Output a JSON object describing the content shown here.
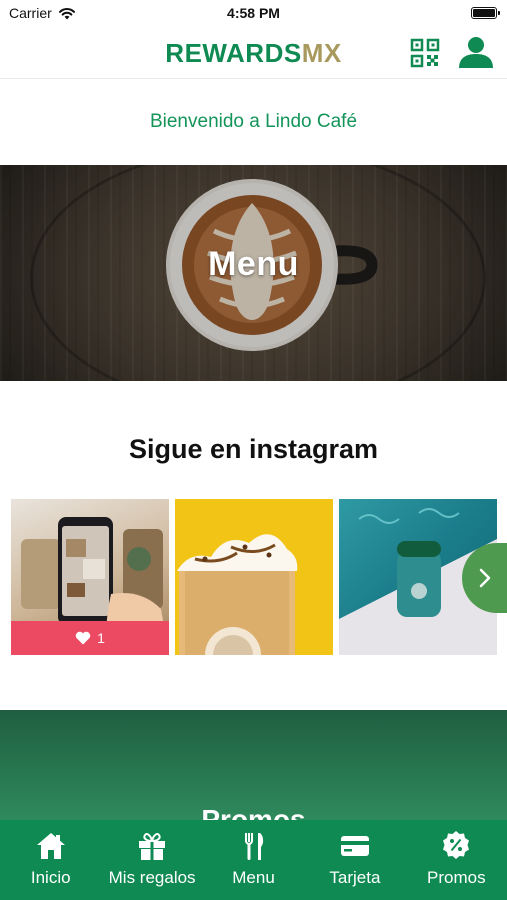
{
  "status_bar": {
    "carrier": "Carrier",
    "time": "4:58 PM"
  },
  "header": {
    "brand_part1": "REWARDS",
    "brand_part2": "MX",
    "qr_icon": "qr-code-icon",
    "profile_icon": "user-icon"
  },
  "welcome": "Bienvenido a Lindo Café",
  "menu_banner": {
    "label": "Menu"
  },
  "instagram": {
    "title": "Sigue en instagram",
    "posts": [
      {
        "subject": "phone photo",
        "likes": "1"
      },
      {
        "subject": "frappuccino"
      },
      {
        "subject": "tumbler"
      }
    ]
  },
  "promos": {
    "title": "Promos"
  },
  "tabs": [
    {
      "label": "Inicio",
      "icon": "home-icon"
    },
    {
      "label": "Mis regalos",
      "icon": "gift-icon"
    },
    {
      "label": "Menu",
      "icon": "fork-knife-icon"
    },
    {
      "label": "Tarjeta",
      "icon": "card-icon"
    },
    {
      "label": "Promos",
      "icon": "percent-icon"
    }
  ],
  "colors": {
    "brand_green": "#0f8a53",
    "brand_gold": "#a89a5e",
    "like_red": "#ec4a63",
    "promo_green": "#2e8a5c"
  }
}
